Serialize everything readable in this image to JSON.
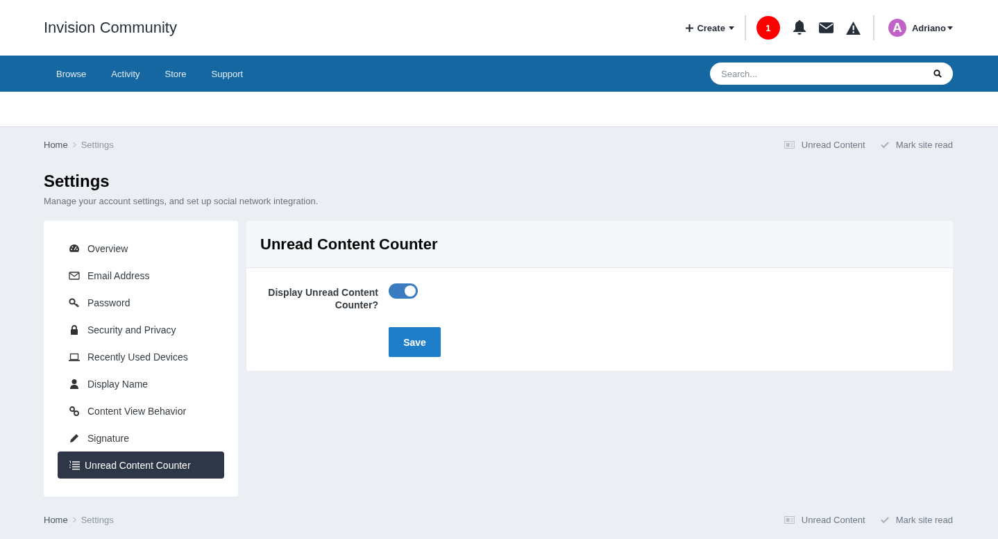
{
  "header": {
    "site_title": "Invision Community",
    "create_label": "Create",
    "notification_count": "1",
    "user": {
      "initial": "A",
      "name": "Adriano"
    }
  },
  "nav": {
    "items": [
      {
        "label": "Browse",
        "selected": false
      },
      {
        "label": "Activity",
        "selected": false
      },
      {
        "label": "Store",
        "selected": false
      },
      {
        "label": "Support",
        "selected": false
      }
    ],
    "search": {
      "placeholder": "Search..."
    }
  },
  "breadcrumb_top": {
    "items": [
      "Home",
      "Settings"
    ],
    "actions": [
      "Unread Content",
      "Mark site read"
    ]
  },
  "page": {
    "title": "Settings",
    "subtitle": "Manage your account settings, and set up social network integration."
  },
  "sidebar": {
    "items": [
      {
        "label": "Overview",
        "selected": false
      },
      {
        "label": "Email Address",
        "selected": false
      },
      {
        "label": "Password",
        "selected": false
      },
      {
        "label": "Security and Privacy",
        "selected": false
      },
      {
        "label": "Recently Used Devices",
        "selected": false
      },
      {
        "label": "Display Name",
        "selected": false
      },
      {
        "label": "Content View Behavior",
        "selected": false
      },
      {
        "label": "Signature",
        "selected": false
      },
      {
        "label": "Unread Content Counter",
        "selected": true
      }
    ]
  },
  "panel": {
    "title": "Unread Content Counter",
    "setting": {
      "label": "Display Unread Content Counter?",
      "on": true
    },
    "save_button": "Save"
  },
  "breadcrumb_bottom": {
    "items": [
      "Home",
      "Settings"
    ],
    "actions": [
      "Unread Content",
      "Mark site read"
    ]
  }
}
